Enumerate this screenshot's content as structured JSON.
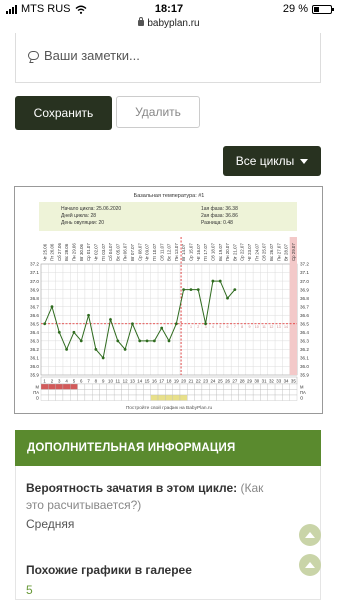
{
  "status": {
    "carrier": "MTS RUS",
    "time": "18:17",
    "battery": "29 %"
  },
  "browser": {
    "url": "babyplan.ru"
  },
  "notes": {
    "placeholder": "Ваши заметки..."
  },
  "buttons": {
    "save": "Сохранить",
    "delete": "Удалить",
    "cycles": "Все циклы"
  },
  "chart_data": {
    "type": "line",
    "title": "Базальная температура: #1",
    "stats": {
      "cycle_start": "Начало цикла: 25.06.2020",
      "cycle_days": "Дней цикла: 28",
      "ovulation_day": "День овуляции: 20",
      "phase1": "1ая фаза: 36.38",
      "phase2": "2ая фаза: 36.86",
      "difference": "Разница: 0.48"
    },
    "dates": [
      "Чт 25.06",
      "Пт 26.06",
      "Сб 27.06",
      "Вс 28.06",
      "Пн 29.06",
      "Вт 30.06",
      "Ср 01.07",
      "Чт 02.07",
      "Пт 03.07",
      "Сб 04.07",
      "Вс 05.07",
      "Пн 06.07",
      "Вт 07.07",
      "Ср 08.07",
      "Чт 09.07",
      "Пт 10.07",
      "Сб 11.07",
      "Вс 12.07",
      "Пн 13.07",
      "Вт 14.07",
      "Ср 15.07",
      "Чт 16.07",
      "Пт 17.07",
      "Сб 18.07",
      "Вс 19.07",
      "Пн 20.07",
      "Вт 21.07",
      "Ср 22.07",
      "Чт 23.07",
      "Пт 24.07",
      "Сб 25.07",
      "Вс 26.07",
      "Пн 27.07",
      "Вт 28.07",
      "Ср 29.07"
    ],
    "days": [
      1,
      2,
      3,
      4,
      5,
      6,
      7,
      8,
      9,
      10,
      11,
      12,
      13,
      14,
      15,
      16,
      17,
      18,
      19,
      20,
      21,
      22,
      23,
      24,
      25,
      26,
      27,
      28,
      29,
      30,
      31,
      32,
      33,
      34,
      35
    ],
    "temps": [
      36.5,
      36.7,
      36.4,
      36.2,
      36.4,
      36.3,
      36.6,
      36.2,
      36.1,
      36.55,
      36.3,
      36.2,
      36.5,
      36.3,
      36.3,
      36.3,
      36.45,
      36.3,
      36.5,
      36.9,
      36.9,
      36.9,
      36.5,
      37.0,
      37.0,
      36.8,
      36.9
    ],
    "y_ticks": [
      "37.2",
      "37.1",
      "37.0",
      "36.9",
      "36.8",
      "36.7",
      "36.6",
      "36.5",
      "36.4",
      "36.3",
      "36.2",
      "36.1",
      "36.0",
      "35.9"
    ],
    "ylim": [
      35.9,
      37.2
    ],
    "coverline": 36.5,
    "ovulation_day": 20,
    "row_labels": [
      "М",
      "ПА",
      "О"
    ],
    "footer": "Постройте свой график на BabyPlan.ru"
  },
  "info": {
    "header": "ДОПОЛНИТЕЛЬНАЯ ИНФОРМАЦИЯ",
    "question": "Вероятность зачатия в этом цикле:",
    "question_link": "(Как это расчитывается?)",
    "answer": "Средняя",
    "similar_label": "Похожие графики в галерее",
    "similar_count": "5"
  }
}
